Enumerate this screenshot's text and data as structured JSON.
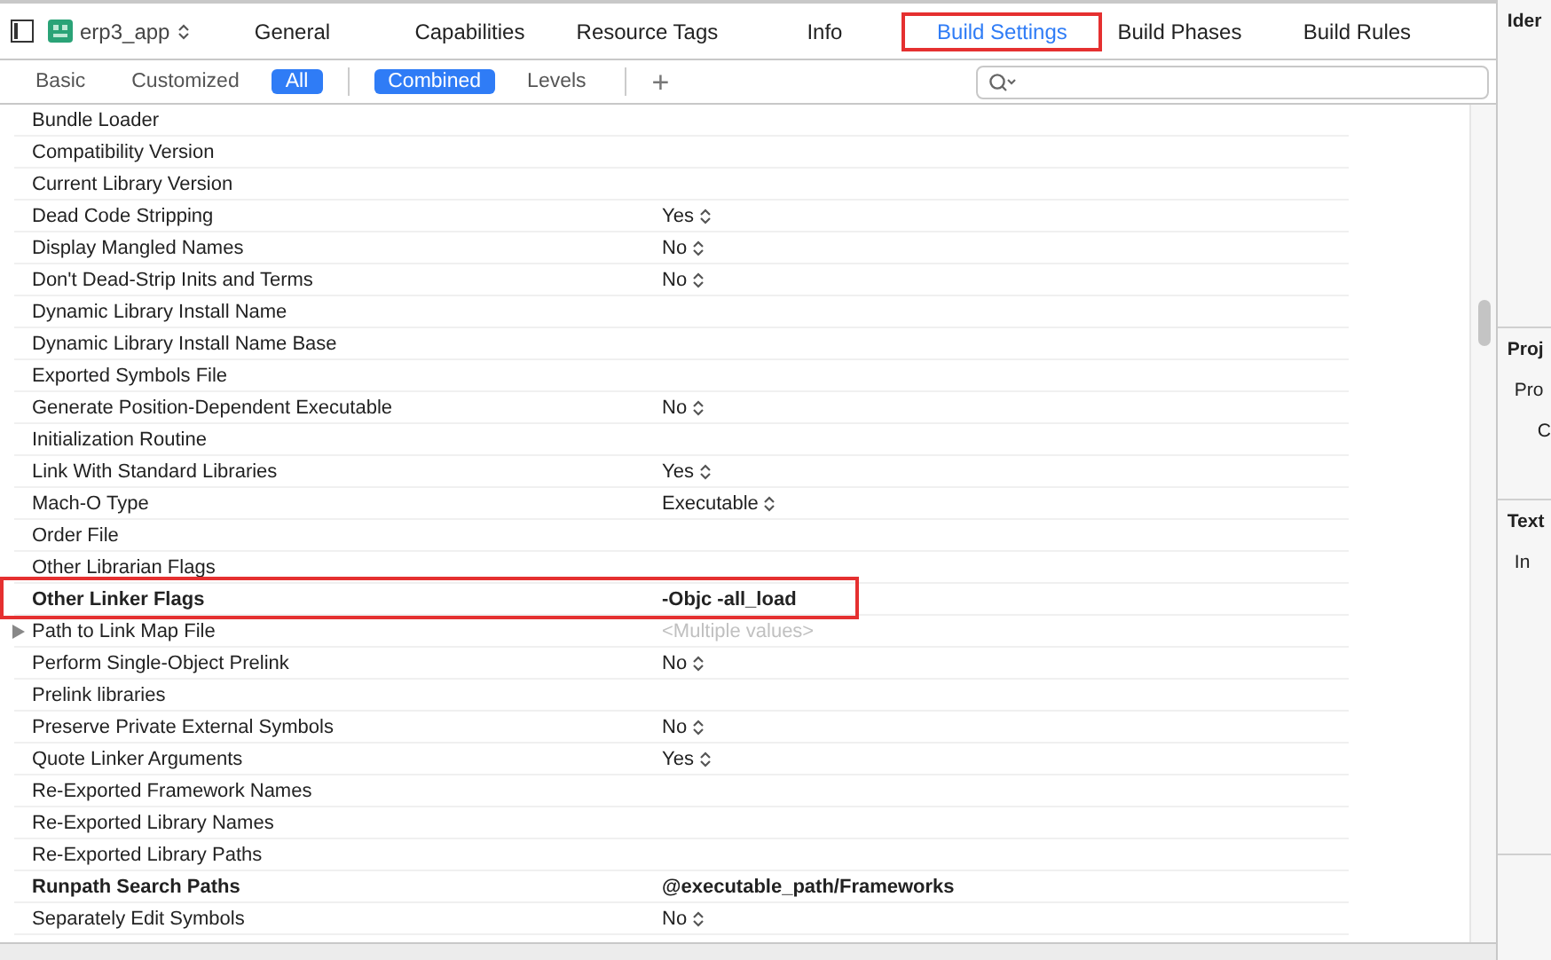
{
  "project": {
    "name": "erp3_app"
  },
  "tabs": [
    {
      "label": "General",
      "selected": false,
      "highlighted": false
    },
    {
      "label": "Capabilities",
      "selected": false,
      "highlighted": false
    },
    {
      "label": "Resource Tags",
      "selected": false,
      "highlighted": false
    },
    {
      "label": "Info",
      "selected": false,
      "highlighted": false
    },
    {
      "label": "Build Settings",
      "selected": true,
      "highlighted": true
    },
    {
      "label": "Build Phases",
      "selected": false,
      "highlighted": false
    },
    {
      "label": "Build Rules",
      "selected": false,
      "highlighted": false
    }
  ],
  "scope_filters": [
    {
      "label": "Basic",
      "selected": false
    },
    {
      "label": "Customized",
      "selected": false
    },
    {
      "label": "All",
      "selected": true
    }
  ],
  "view_filters": [
    {
      "label": "Combined",
      "selected": true
    },
    {
      "label": "Levels",
      "selected": false
    }
  ],
  "add_button": "+",
  "settings": [
    {
      "name": "Bundle Loader",
      "kind": "text"
    },
    {
      "name": "Compatibility Version",
      "kind": "text"
    },
    {
      "name": "Current Library Version",
      "kind": "text"
    },
    {
      "name": "Dead Code Stripping",
      "kind": "stepper",
      "value": "Yes"
    },
    {
      "name": "Display Mangled Names",
      "kind": "stepper",
      "value": "No"
    },
    {
      "name": "Don't Dead-Strip Inits and Terms",
      "kind": "stepper",
      "value": "No"
    },
    {
      "name": "Dynamic Library Install Name",
      "kind": "text"
    },
    {
      "name": "Dynamic Library Install Name Base",
      "kind": "text"
    },
    {
      "name": "Exported Symbols File",
      "kind": "text"
    },
    {
      "name": "Generate Position-Dependent Executable",
      "kind": "stepper",
      "value": "No"
    },
    {
      "name": "Initialization Routine",
      "kind": "text"
    },
    {
      "name": "Link With Standard Libraries",
      "kind": "stepper",
      "value": "Yes"
    },
    {
      "name": "Mach-O Type",
      "kind": "stepper",
      "value": "Executable"
    },
    {
      "name": "Order File",
      "kind": "text"
    },
    {
      "name": "Other Librarian Flags",
      "kind": "text"
    },
    {
      "name": "Other Linker Flags",
      "kind": "text",
      "value": "-Objc -all_load",
      "bold": true,
      "highlighted": true
    },
    {
      "name": "Path to Link Map File",
      "kind": "multiple",
      "value": "<Multiple values>",
      "expanded": false
    },
    {
      "name": "Perform Single-Object Prelink",
      "kind": "stepper",
      "value": "No"
    },
    {
      "name": "Prelink libraries",
      "kind": "text"
    },
    {
      "name": "Preserve Private External Symbols",
      "kind": "stepper",
      "value": "No"
    },
    {
      "name": "Quote Linker Arguments",
      "kind": "stepper",
      "value": "Yes"
    },
    {
      "name": "Re-Exported Framework Names",
      "kind": "text"
    },
    {
      "name": "Re-Exported Library Names",
      "kind": "text"
    },
    {
      "name": "Re-Exported Library Paths",
      "kind": "text"
    },
    {
      "name": "Runpath Search Paths",
      "kind": "text",
      "value": "@executable_path/Frameworks",
      "bold": true
    },
    {
      "name": "Separately Edit Symbols",
      "kind": "stepper",
      "value": "No"
    }
  ],
  "inspector": [
    {
      "title": "Ider"
    },
    {
      "title": "Proj",
      "lines": [
        "Pro",
        "C"
      ]
    },
    {
      "title": "Text",
      "lines": [
        "In"
      ]
    }
  ]
}
